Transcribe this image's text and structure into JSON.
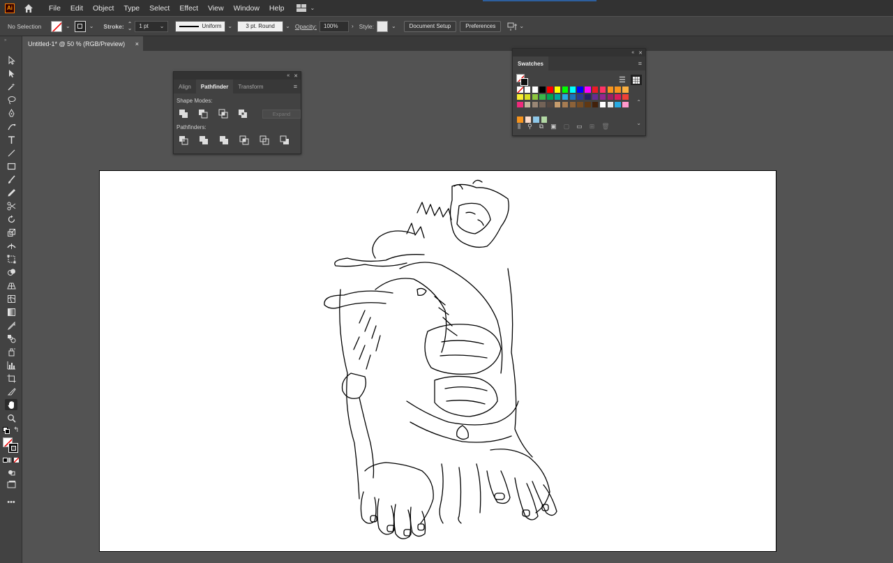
{
  "app": {
    "logo": "Ai"
  },
  "menu": [
    "File",
    "Edit",
    "Object",
    "Type",
    "Select",
    "Effect",
    "View",
    "Window",
    "Help"
  ],
  "control": {
    "selection": "No Selection",
    "stroke_label": "Stroke:",
    "stroke_weight": "1 pt",
    "profile": "Uniform",
    "brush": "3 pt. Round",
    "opacity_label": "Opacity:",
    "opacity": "100%",
    "style_label": "Style:",
    "document_setup": "Document Setup",
    "preferences": "Preferences"
  },
  "document": {
    "tab_title": "Untitled-1* @ 50 % (RGB/Preview)",
    "close": "×"
  },
  "pathfinder": {
    "tabs": [
      "Align",
      "Pathfinder",
      "Transform"
    ],
    "active_tab": "Pathfinder",
    "shape_modes": "Shape Modes:",
    "pathfinders": "Pathfinders:",
    "expand": "Expand"
  },
  "swatches": {
    "title": "Swatches",
    "colors": [
      "none",
      "#ffffff",
      "#ffffff",
      "#000000",
      "#ff0000",
      "#ffff00",
      "#00ff00",
      "#00ffff",
      "#0000ff",
      "#ff00ff",
      "#ed1c24",
      "#ff3366",
      "#f7941d",
      "#f7941d",
      "#fbb040",
      "#f9ed32",
      "#d7df23",
      "#8dc63f",
      "#39b54a",
      "#00a651",
      "#00a99d",
      "#27aae1",
      "#1c75bc",
      "#2b3990",
      "#262262",
      "#662d91",
      "#92278f",
      "#9e1f63",
      "#da1c5c",
      "#ef4136",
      "#ee2a7b",
      "#c2b59b",
      "#998675",
      "#736357",
      "#534741",
      "#c69c6d",
      "#a67c52",
      "#8c6239",
      "#754c24",
      "#603813",
      "#42210b",
      "#ffffff",
      "#e6e6e6",
      "#27aae1",
      "#ff99cc"
    ]
  }
}
